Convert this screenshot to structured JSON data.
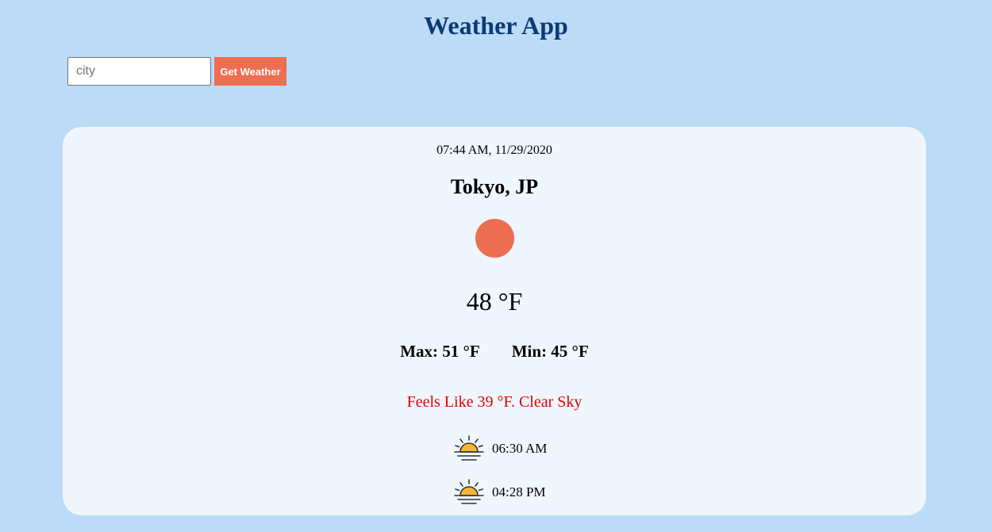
{
  "app": {
    "title": "Weather App"
  },
  "search": {
    "placeholder": "city",
    "value": "",
    "button_label": "Get Weather"
  },
  "weather": {
    "datetime": "07:44 AM, 11/29/2020",
    "location": "Tokyo, JP",
    "icon": "sun-circle-icon",
    "temperature": "48 °F",
    "max": "Max: 51 °F",
    "min": "Min: 45 °F",
    "feels_like": "Feels Like 39 °F. Clear Sky",
    "sunrise": "06:30 AM",
    "sunset": "04:28 PM"
  },
  "colors": {
    "background": "#bbdbf6",
    "card": "#eff6fd",
    "title": "#0b3a75",
    "accent": "#ed6e50",
    "feels_like": "#e00000"
  }
}
